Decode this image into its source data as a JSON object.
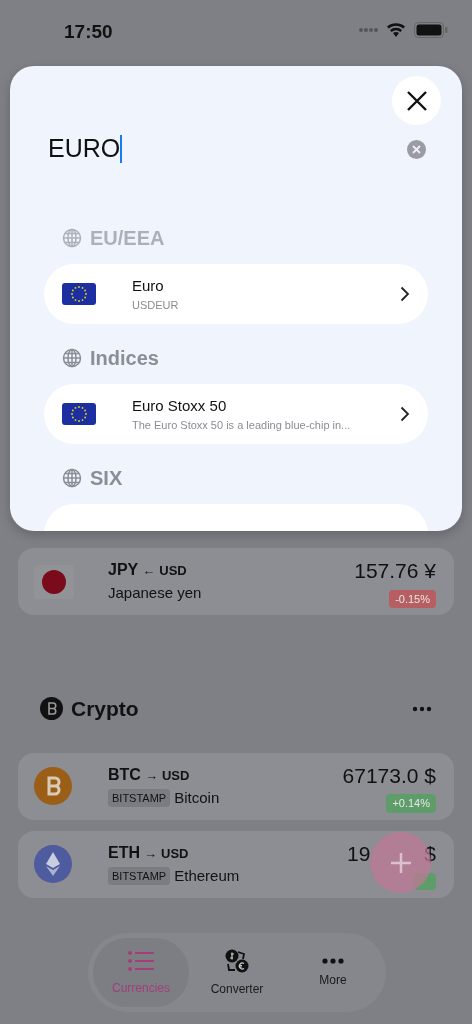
{
  "status_bar": {
    "time": "17:50"
  },
  "sheet": {
    "search": {
      "value": "EURO"
    },
    "sections": [
      {
        "title": "EU/EEA",
        "faded": true,
        "items": [
          {
            "title": "Euro",
            "subtitle": "USDEUR",
            "kind": "flag"
          }
        ]
      },
      {
        "title": "Indices",
        "faded": false,
        "items": [
          {
            "title": "Euro Stoxx 50",
            "subtitle": "The Euro Stoxx 50 is a leading blue-chip in...",
            "kind": "flag"
          }
        ]
      },
      {
        "title": "SIX",
        "faded": false,
        "items": [
          {
            "kind": "cut"
          }
        ]
      }
    ]
  },
  "fiat_rows": [
    {
      "code": "JPY",
      "arrow": "←",
      "base": "USD",
      "name": "Japanese yen",
      "price": "157.76 ¥",
      "change": "-0.15%",
      "color": "#b65e62",
      "kind": "jp"
    }
  ],
  "crypto": {
    "title": "Crypto",
    "rows": [
      {
        "code": "BTC",
        "arrow": "→",
        "base": "USD",
        "exchange": "BITSTAMP",
        "name": "Bitcoin",
        "price": "67173.0 $",
        "change": "+0.14%",
        "color": "#5e9d69",
        "kind": "btc"
      },
      {
        "code": "ETH",
        "arrow": "→",
        "base": "USD",
        "exchange": "BITSTAMP",
        "name": "Ethereum",
        "price": "19",
        "price_suffix": "$",
        "color": "#5e9d69",
        "kind": "eth"
      }
    ]
  },
  "tabs": [
    {
      "label": "Currencies",
      "selected": true,
      "kind": "list"
    },
    {
      "label": "Converter",
      "selected": false,
      "kind": "exchange"
    },
    {
      "label": "More",
      "selected": false,
      "kind": "dots"
    }
  ]
}
